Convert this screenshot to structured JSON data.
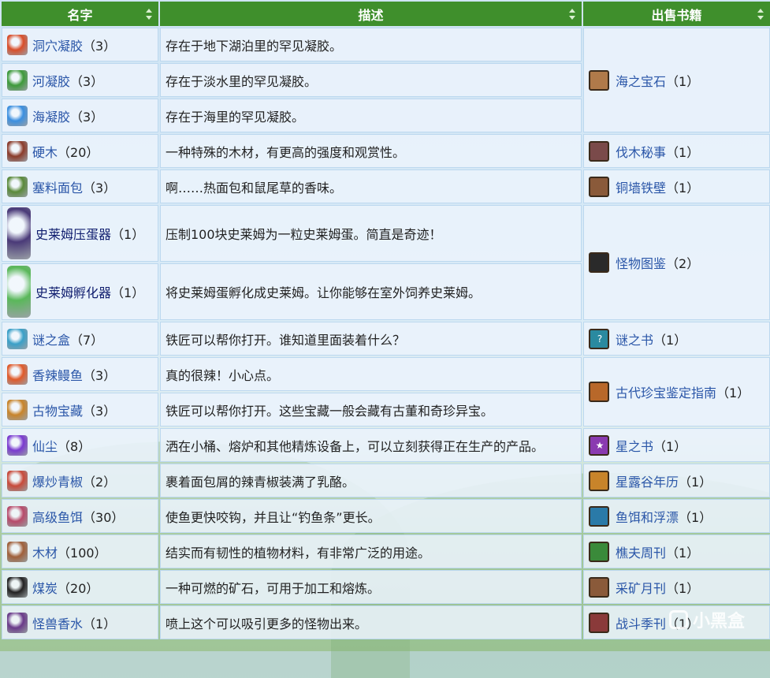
{
  "headers": {
    "name": "名字",
    "desc": "描述",
    "book": "出售书籍"
  },
  "rows": [
    {
      "name": "洞穴凝胶",
      "qty": "（3）",
      "desc": "存在于地下湖泊里的罕见凝胶。",
      "icon": "cave-jelly-icon",
      "color": "#d94e2a"
    },
    {
      "name": "河凝胶",
      "qty": "（3）",
      "desc": "存在于淡水里的罕见凝胶。",
      "icon": "river-jelly-icon",
      "color": "#3d9a3a"
    },
    {
      "name": "海凝胶",
      "qty": "（3）",
      "desc": "存在于海里的罕见凝胶。",
      "icon": "sea-jelly-icon",
      "color": "#3b8fe0"
    },
    {
      "name": "硬木",
      "qty": "（20）",
      "desc": "一种特殊的木材，有更高的强度和观赏性。",
      "icon": "hardwood-icon",
      "color": "#8b3b2a"
    },
    {
      "name": "塞料面包",
      "qty": "（3）",
      "desc": "啊……热面包和鼠尾草的香味。",
      "icon": "stuffing-icon",
      "color": "#5a8a3a"
    },
    {
      "name": "史莱姆压蛋器",
      "qty": "（1）",
      "desc": "压制100块史莱姆为一粒史莱姆蛋。简直是奇迹！",
      "icon": "slime-egg-press-icon",
      "color": "#4a3a78"
    },
    {
      "name": "史莱姆孵化器",
      "qty": "（1）",
      "desc": "将史莱姆蛋孵化成史莱姆。让你能够在室外饲养史莱姆。",
      "icon": "slime-incubator-icon",
      "color": "#5ab85a"
    },
    {
      "name": "谜之盒",
      "qty": "（7）",
      "desc": "铁匠可以帮你打开。谁知道里面装着什么？",
      "icon": "mystery-box-icon",
      "color": "#3aa0c8"
    },
    {
      "name": "香辣鳗鱼",
      "qty": "（3）",
      "desc": "真的很辣！小心点。",
      "icon": "spicy-eel-icon",
      "color": "#e05a2a"
    },
    {
      "name": "古物宝藏",
      "qty": "（3）",
      "desc": "铁匠可以帮你打开。这些宝藏一般会藏有古董和奇珍异宝。",
      "icon": "artifact-trove-icon",
      "color": "#c8842a"
    },
    {
      "name": "仙尘",
      "qty": "（8）",
      "desc": "洒在小桶、熔炉和其他精炼设备上，可以立刻获得正在生产的产品。",
      "icon": "fairy-dust-icon",
      "color": "#7a3ad0"
    },
    {
      "name": "爆炒青椒",
      "qty": "（2）",
      "desc": "裹着面包屑的辣青椒装满了乳酪。",
      "icon": "poppers-icon",
      "color": "#c84a3a"
    },
    {
      "name": "高级鱼饵",
      "qty": "（30）",
      "desc": "使鱼更快咬钩，并且让“钓鱼条”更长。",
      "icon": "deluxe-bait-icon",
      "color": "#b84a6a"
    },
    {
      "name": "木材",
      "qty": "（100）",
      "desc": "结实而有韧性的植物材料，有非常广泛的用途。",
      "icon": "wood-icon",
      "color": "#a0603a"
    },
    {
      "name": "煤炭",
      "qty": "（20）",
      "desc": "一种可燃的矿石，可用于加工和熔炼。",
      "icon": "coal-icon",
      "color": "#222222"
    },
    {
      "name": "怪兽香水",
      "qty": "（1）",
      "desc": "喷上这个可以吸引更多的怪物出来。",
      "icon": "monster-musk-icon",
      "color": "#6a3a8a"
    }
  ],
  "books": [
    {
      "name": "海之宝石",
      "qty": "（1）",
      "span": 3,
      "icon": "book-jewels-of-the-sea-icon",
      "color": "#b07a4a",
      "glyph": ""
    },
    {
      "name": "伐木秘事",
      "qty": "（1）",
      "span": 1,
      "icon": "book-woodcutters-weekly-icon",
      "color": "#7a4a4a",
      "glyph": ""
    },
    {
      "name": "铜墙铁壁",
      "qty": "（1）",
      "span": 1,
      "icon": "book-defense-icon",
      "color": "#8a5a3a",
      "glyph": ""
    },
    {
      "name": "怪物图鉴",
      "qty": "（2）",
      "span": 2,
      "icon": "book-monster-compendium-icon",
      "color": "#2a2a2a",
      "glyph": ""
    },
    {
      "name": "谜之书",
      "qty": "（1）",
      "span": 1,
      "icon": "book-mystery-icon",
      "color": "#2a8aa0",
      "glyph": "?"
    },
    {
      "name": "古代珍宝鉴定指南",
      "qty": "（1）",
      "span": 2,
      "icon": "book-ancient-treasures-icon",
      "color": "#b8682a",
      "glyph": ""
    },
    {
      "name": "星之书",
      "qty": "（1）",
      "span": 1,
      "icon": "book-of-stars-icon",
      "color": "#8a3ab0",
      "glyph": "★"
    },
    {
      "name": "星露谷年历",
      "qty": "（1）",
      "span": 1,
      "icon": "book-stardew-almanac-icon",
      "color": "#c8842a",
      "glyph": ""
    },
    {
      "name": "鱼饵和浮漂",
      "qty": "（1）",
      "span": 1,
      "icon": "book-bait-and-bobber-icon",
      "color": "#2a7aa8",
      "glyph": ""
    },
    {
      "name": "樵夫周刊",
      "qty": "（1）",
      "span": 1,
      "icon": "book-woody-weekly-icon",
      "color": "#3a8a3a",
      "glyph": ""
    },
    {
      "name": "采矿月刊",
      "qty": "（1）",
      "span": 1,
      "icon": "book-mining-monthly-icon",
      "color": "#8a5a3a",
      "glyph": ""
    },
    {
      "name": "战斗季刊",
      "qty": "（1）",
      "span": 1,
      "icon": "book-combat-quarterly-icon",
      "color": "#8a3a3a",
      "glyph": ""
    }
  ],
  "watermark": "小黑盒"
}
